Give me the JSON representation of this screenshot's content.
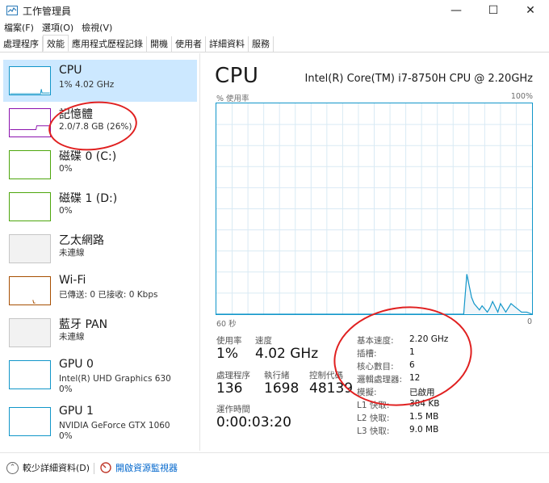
{
  "window": {
    "title": "工作管理員",
    "minimize": "—",
    "maximize": "☐",
    "close": "✕"
  },
  "menu": [
    "檔案(F)",
    "選項(O)",
    "檢視(V)"
  ],
  "tabs": [
    "處理程序",
    "效能",
    "應用程式歷程記錄",
    "開機",
    "使用者",
    "詳細資料",
    "服務"
  ],
  "active_tab": 1,
  "sidebar": [
    {
      "name": "CPU",
      "sub": "1%  4.02 GHz",
      "color": "#1196c9",
      "active": true
    },
    {
      "name": "記憶體",
      "sub": "2.0/7.8 GB (26%)",
      "color": "#8b12ae"
    },
    {
      "name": "磁碟 0 (C:)",
      "sub": "0%",
      "color": "#4da60c"
    },
    {
      "name": "磁碟 1 (D:)",
      "sub": "0%",
      "color": "#4da60c"
    },
    {
      "name": "乙太網路",
      "sub": "未連線",
      "color": "#c6c6c6"
    },
    {
      "name": "Wi-Fi",
      "sub": "已傳送: 0  已接收: 0 Kbps",
      "color": "#a74f01"
    },
    {
      "name": "藍牙 PAN",
      "sub": "未連線",
      "color": "#c6c6c6"
    },
    {
      "name": "GPU 0",
      "sub": "Intel(R) UHD Graphics 630",
      "sub2": "0%",
      "color": "#1196c9"
    },
    {
      "name": "GPU 1",
      "sub": "NVIDIA GeForce GTX 1060",
      "sub2": "0%",
      "color": "#1196c9"
    }
  ],
  "main": {
    "title": "CPU",
    "model": "Intel(R) Core(TM) i7-8750H CPU @ 2.20GHz",
    "y_label": "% 使用率",
    "y_max_label": "100%",
    "x_left_label": "60 秒",
    "x_right_label": "0"
  },
  "chart_data": {
    "type": "area",
    "ylim": [
      0,
      100
    ],
    "xlim": [
      60,
      0
    ],
    "x": [
      60,
      13,
      12.4,
      11.5,
      11,
      10,
      9.5,
      8.5,
      8,
      7.5,
      6.5,
      6,
      5,
      4,
      3,
      2,
      1,
      0
    ],
    "values": [
      0,
      0,
      19,
      8,
      5,
      2,
      4,
      1,
      3,
      6,
      1,
      5,
      1,
      5,
      3,
      1,
      1,
      0
    ],
    "line_color": "#1196c9",
    "fill_color": "#f1f6fa",
    "grid": true
  },
  "stats": {
    "usage_label": "使用率",
    "usage_value": "1%",
    "speed_label": "速度",
    "speed_value": "4.02 GHz",
    "proc_label": "處理程序",
    "proc_value": "136",
    "threads_label": "執行緒",
    "threads_value": "1698",
    "handles_label": "控制代碼",
    "handles_value": "48139",
    "uptime_label": "運作時間",
    "uptime_value": "0:00:03:20"
  },
  "specs": [
    {
      "label": "基本速度:",
      "value": "2.20 GHz"
    },
    {
      "label": "插槽:",
      "value": "1"
    },
    {
      "label": "核心數目:",
      "value": "6"
    },
    {
      "label": "邏輯處理器:",
      "value": "12"
    },
    {
      "label": "模擬:",
      "value": "已啟用"
    },
    {
      "label": "L1 快取:",
      "value": "384 KB"
    },
    {
      "label": "L2 快取:",
      "value": "1.5 MB"
    },
    {
      "label": "L3 快取:",
      "value": "9.0 MB"
    }
  ],
  "bottom": {
    "fewer": "較少詳細資料(D)",
    "monitor": "開啟資源監視器"
  }
}
